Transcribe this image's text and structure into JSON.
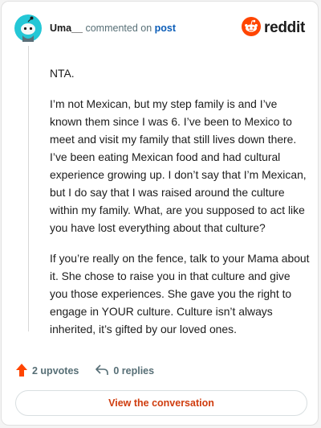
{
  "comment": {
    "username": "Uma__",
    "commented_on_text": "commented on",
    "post_link_text": "post",
    "avatar_icon": "snoo-avatar-icon",
    "paragraphs": [
      "NTA.",
      "I’m not Mexican, but my step family is and I’ve known them since I was 6. I’ve been to Mexico to meet and visit my family that still lives down there. I’ve been eating Mexican food and had cultural experience growing up. I don’t say that I’m Mexican, but I do say that I was raised around the culture within my family. What, are you supposed to act like you have lost everything about that culture?",
      "If you’re really on the fence, talk to your Mama about it. She chose to raise you in that culture and give you those experiences. She gave you the right to engage in YOUR culture. Culture isn’t always inherited, it’s gifted by our loved ones."
    ]
  },
  "brand": {
    "wordmark": "reddit",
    "icon": "reddit-logo-icon",
    "color": "#ff4500"
  },
  "actions": {
    "upvotes_label": "2 upvotes",
    "replies_label": "0 replies",
    "upvote_icon": "upvote-arrow-icon",
    "reply_icon": "reply-arrow-icon"
  },
  "cta": {
    "label": "View the conversation",
    "color": "#cf3c0e"
  }
}
